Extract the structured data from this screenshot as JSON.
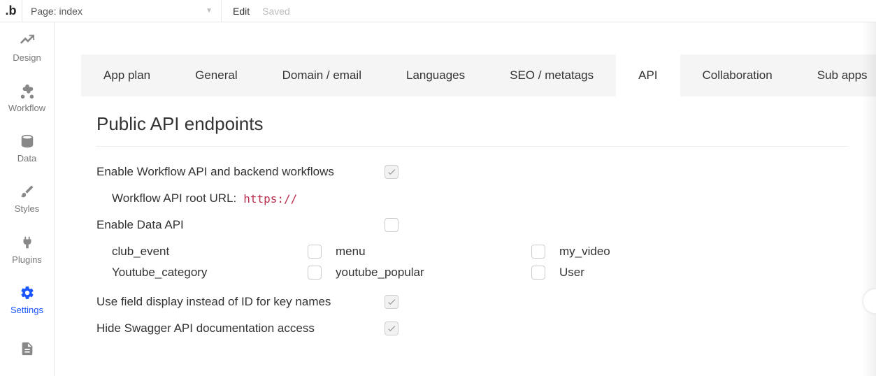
{
  "topbar": {
    "page_label": "Page: index",
    "edit": "Edit",
    "saved": "Saved"
  },
  "sidebar": {
    "items": [
      {
        "id": "design",
        "label": "Design",
        "icon": "design"
      },
      {
        "id": "workflow",
        "label": "Workflow",
        "icon": "workflow"
      },
      {
        "id": "data",
        "label": "Data",
        "icon": "data"
      },
      {
        "id": "styles",
        "label": "Styles",
        "icon": "styles"
      },
      {
        "id": "plugins",
        "label": "Plugins",
        "icon": "plugins"
      },
      {
        "id": "settings",
        "label": "Settings",
        "icon": "settings",
        "active": true
      },
      {
        "id": "logs",
        "label": "",
        "icon": "logs"
      }
    ]
  },
  "tabs": [
    {
      "id": "appplan",
      "label": "App plan"
    },
    {
      "id": "general",
      "label": "General"
    },
    {
      "id": "domain",
      "label": "Domain / email"
    },
    {
      "id": "languages",
      "label": "Languages"
    },
    {
      "id": "seo",
      "label": "SEO / metatags"
    },
    {
      "id": "api",
      "label": "API",
      "active": true
    },
    {
      "id": "collaboration",
      "label": "Collaboration"
    },
    {
      "id": "subapps",
      "label": "Sub apps"
    }
  ],
  "section": {
    "title": "Public API endpoints",
    "enable_workflow_label": "Enable Workflow API and backend workflows",
    "enable_workflow_checked": true,
    "root_url_label": "Workflow API root URL:",
    "root_url_value": "https://",
    "enable_data_label": "Enable Data API",
    "enable_data_checked": false,
    "data_types": [
      {
        "name": "club_event",
        "checked": false
      },
      {
        "name": "menu",
        "checked": false
      },
      {
        "name": "my_video",
        "checked": false
      },
      {
        "name": "Youtube_category",
        "checked": false
      },
      {
        "name": "youtube_popular",
        "checked": false
      },
      {
        "name": "User",
        "checked": false
      }
    ],
    "use_field_display_label": "Use field display instead of ID for key names",
    "use_field_display_checked": true,
    "hide_swagger_label": "Hide Swagger API documentation access",
    "hide_swagger_checked": true
  }
}
